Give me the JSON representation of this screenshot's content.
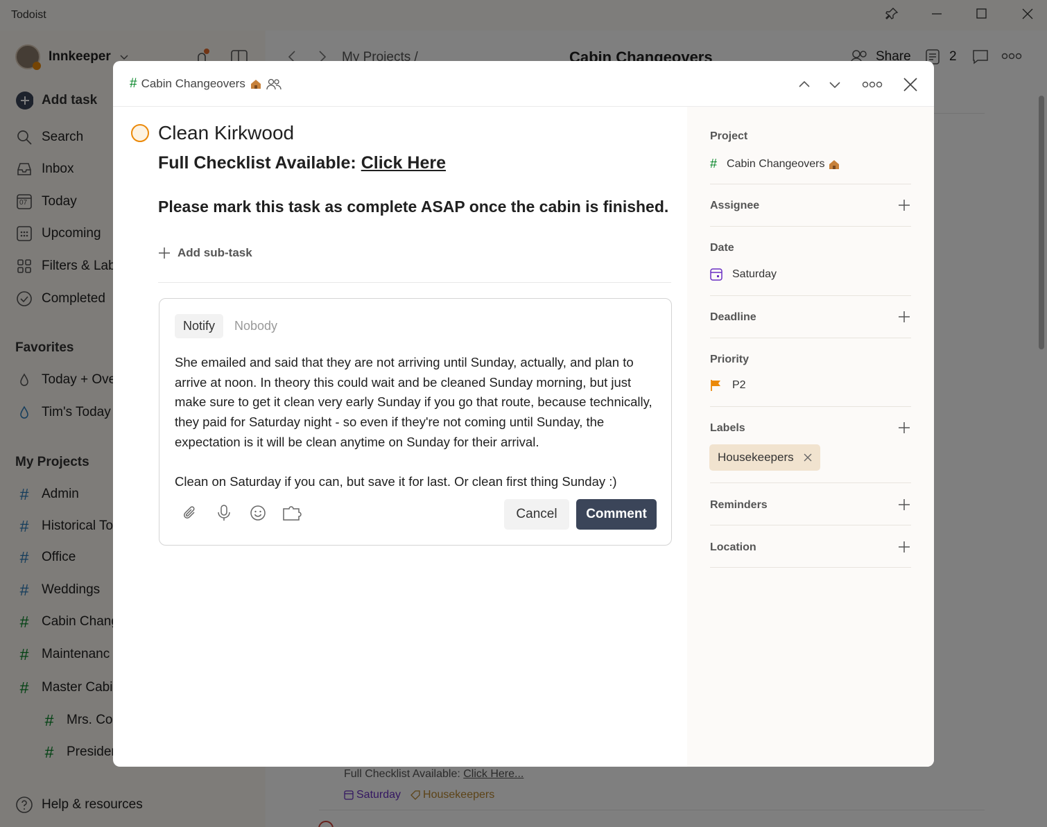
{
  "window": {
    "title": "Todoist"
  },
  "sidebar": {
    "user": "Innkeeper",
    "add_task": "Add task",
    "nav": [
      {
        "label": "Search"
      },
      {
        "label": "Inbox"
      },
      {
        "label": "Today",
        "date_badge": "07"
      },
      {
        "label": "Upcoming"
      },
      {
        "label": "Filters & Lab"
      },
      {
        "label": "Completed"
      }
    ],
    "favorites_title": "Favorites",
    "favorites": [
      {
        "label": "Today + Ove"
      },
      {
        "label": "Tim's Today"
      }
    ],
    "projects_title": "My Projects",
    "projects": [
      {
        "label": "Admin"
      },
      {
        "label": "Historical To"
      },
      {
        "label": "Office"
      },
      {
        "label": "Weddings"
      },
      {
        "label": "Cabin Chang"
      },
      {
        "label": "Maintenanc"
      },
      {
        "label": "Master Cabi"
      },
      {
        "label": "Mrs. Co"
      },
      {
        "label": "Presider"
      }
    ],
    "help": "Help & resources"
  },
  "main_header": {
    "breadcrumb": "My Projects /",
    "title": "Cabin Changeovers",
    "share": "Share",
    "count": "2"
  },
  "background_task": {
    "desc_prefix": "Full Checklist Available: ",
    "desc_link": "Click Here...",
    "date": "Saturday",
    "label": "Housekeepers"
  },
  "modal": {
    "project_crumb": "Cabin Changeovers",
    "task": {
      "title": "Clean Kirkwood",
      "desc_prefix": "Full Checklist Available: ",
      "desc_link": "Click Here",
      "desc_line2": "Please mark this task as complete ASAP once the cabin is finished.",
      "add_subtask": "Add sub-task"
    },
    "comment": {
      "notify_label": "Notify",
      "notify_value": "Nobody",
      "text": "She emailed and said that they are not arriving until Sunday, actually, and plan to arrive at noon. In theory this could wait and be cleaned Sunday morning, but just make sure to get it clean very early Sunday if you go that route, because technically, they paid for Saturday night - so even if they're not coming until Sunday, the expectation is it will be clean anytime on Sunday for their arrival.\n\nClean on Saturday if you can, but save it for last. Or clean first thing Sunday :)",
      "cancel": "Cancel",
      "submit": "Comment"
    },
    "details": {
      "project_label": "Project",
      "project_value": "Cabin Changeovers",
      "assignee_label": "Assignee",
      "date_label": "Date",
      "date_value": "Saturday",
      "deadline_label": "Deadline",
      "priority_label": "Priority",
      "priority_value": "P2",
      "labels_label": "Labels",
      "label_chip": "Housekeepers",
      "reminders_label": "Reminders",
      "location_label": "Location"
    }
  },
  "colors": {
    "accent_green": "#058527",
    "priority_orange": "#eb8909",
    "date_purple": "#692ec2",
    "comment_button": "#3b4559"
  }
}
